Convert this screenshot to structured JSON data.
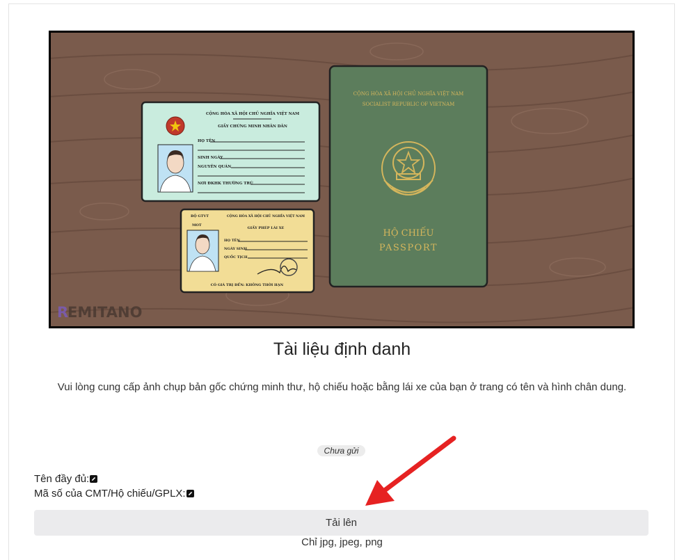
{
  "illustration": {
    "id_card": {
      "header": "CỘNG HÒA XÃ HỘI CHỦ NGHĨA VIỆT NAM",
      "title": "GIẤY CHỨNG MINH NHÂN DÂN",
      "fields": [
        "HỌ TÊN",
        "SINH NGÀY",
        "NGUYÊN QUÁN",
        "NƠI ĐKHK THƯỜNG TRÚ"
      ]
    },
    "license": {
      "issuer": "BỘ GTVT",
      "issuer_sub": "MOT",
      "header": "CỘNG HÒA XÃ HỘI CHỦ NGHĨA VIỆT NAM",
      "title": "GIẤY PHÉP LÁI XE",
      "fields": [
        "HỌ TÊN",
        "NGÀY SINH",
        "QUỐC TỊCH"
      ],
      "validity": "CÓ GIÁ TRỊ ĐẾN: KHÔNG THỜI HẠN"
    },
    "passport": {
      "header_line1": "CỘNG HÒA XÃ HỘI CHỦ NGHĨA VIỆT NAM",
      "header_line2": "SOCIALIST REPUBLIC OF VIETNAM",
      "label_line1": "HỘ CHIẾU",
      "label_line2": "PASSPORT"
    },
    "watermark": {
      "first": "R",
      "rest": "EMITANO"
    }
  },
  "page": {
    "title": "Tài liệu định danh",
    "description": "Vui lòng cung cấp ảnh chụp bản gốc chứng minh thư, hộ chiếu hoặc bằng lái xe của bạn ở trang có tên và hình chân dung.",
    "status_badge": "Chưa gửi",
    "fields": {
      "full_name_label": "Tên đầy đủ:",
      "id_number_label": "Mã số của CMT/Hộ chiếu/GPLX:"
    },
    "upload_button": "Tải lên",
    "upload_hint": "Chỉ jpg, jpeg, png"
  },
  "colors": {
    "wood": "#7a5b4c",
    "id_card": "#c9ecde",
    "license": "#f2dd96",
    "passport": "#5c7d5c",
    "passport_gold": "#d5b65c",
    "button_bg": "#ebebed",
    "arrow": "#e62222"
  }
}
